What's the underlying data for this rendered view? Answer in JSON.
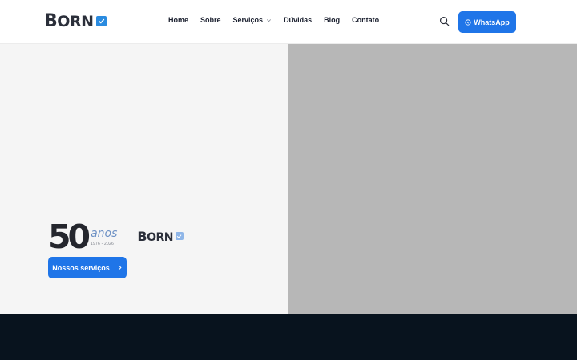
{
  "colors": {
    "accent": "#1f75e8",
    "hero_left_bg": "#f5f5f5",
    "hero_right_bg": "#b7b7b7",
    "dark_band_bg": "#08131e",
    "logo_check_bg": "#2a8be0",
    "logo2_check_bg": "#8fb6e8"
  },
  "header": {
    "logo_text_first": "B",
    "logo_text_rest": "ORN",
    "nav": [
      {
        "label": "Home"
      },
      {
        "label": "Sobre"
      },
      {
        "label": "Serviços",
        "icon": "chevron-down-icon"
      },
      {
        "label": "Dúvidas"
      },
      {
        "label": "Blog"
      },
      {
        "label": "Contato"
      }
    ],
    "search_icon": "search-icon",
    "whatsapp_label": "WhatsApp",
    "whatsapp_icon": "whatsapp-icon"
  },
  "hero": {
    "anniversary_number": "50",
    "anniversary_word": "anos",
    "anniversary_years": "1976 - 2026",
    "logo_text_first": "B",
    "logo_text_rest": "ORN",
    "cta_label": "Nossos serviços",
    "cta_icon": "chevron-right-icon"
  }
}
